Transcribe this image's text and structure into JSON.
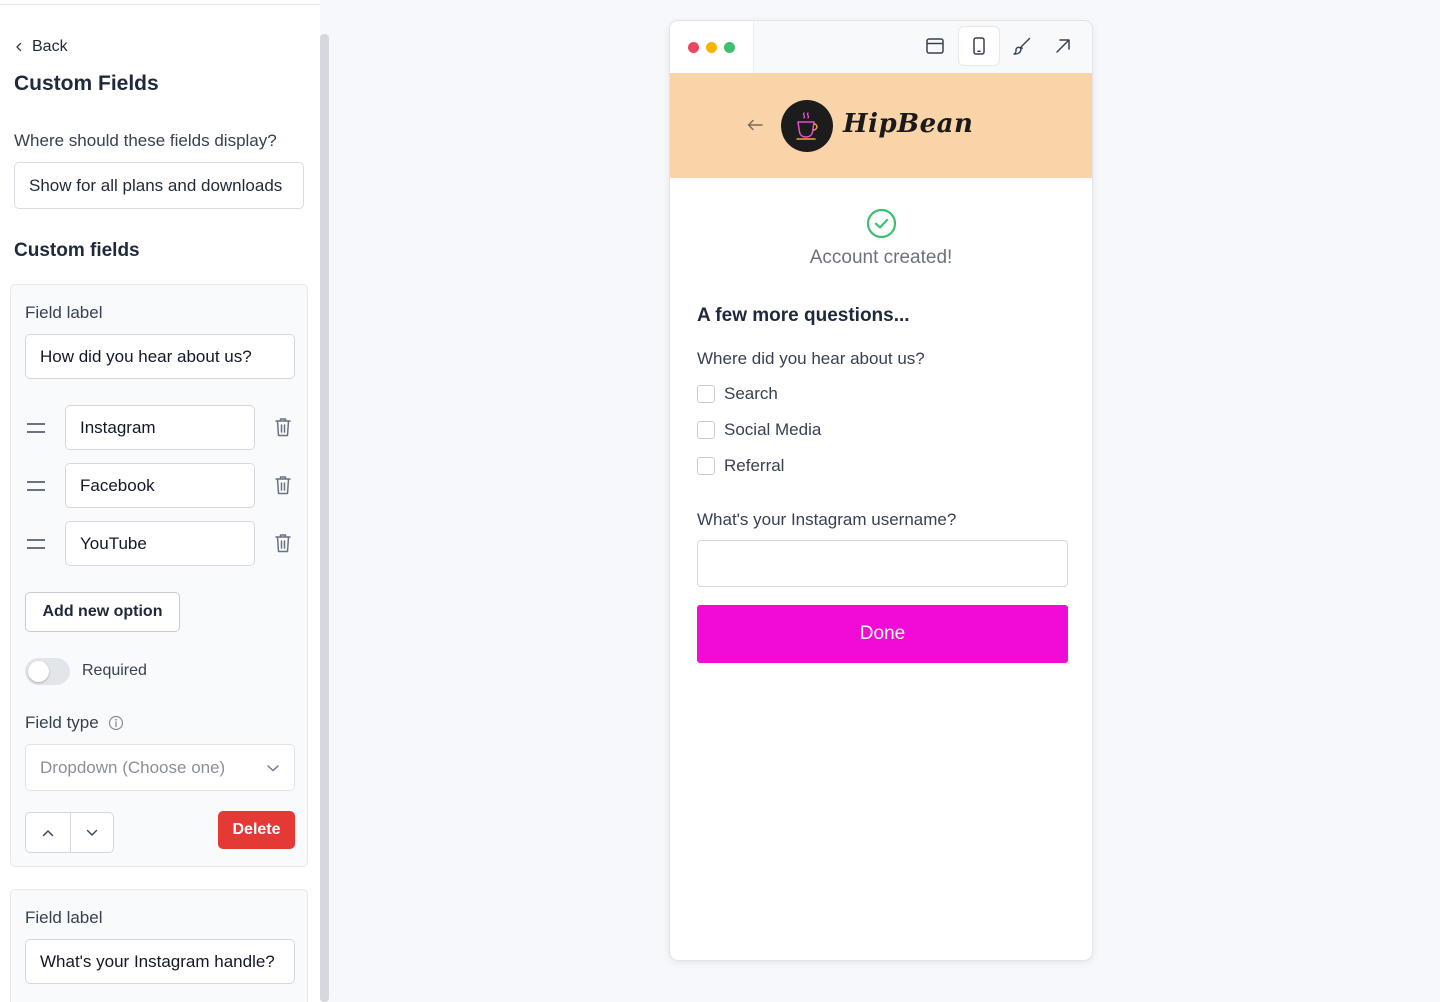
{
  "sidebar": {
    "back_label": "Back",
    "title": "Custom Fields",
    "display_question": "Where should these fields display?",
    "display_value": "Show for all plans and downloads",
    "section_title": "Custom fields",
    "field_1": {
      "label_caption": "Field label",
      "label_value": "How did you hear about us?",
      "options": [
        "Instagram",
        "Facebook",
        "YouTube"
      ],
      "add_option_label": "Add new option",
      "required_label": "Required",
      "required_on": false,
      "field_type_caption": "Field type",
      "field_type_value": "Dropdown (Choose one)",
      "delete_label": "Delete"
    },
    "field_2": {
      "label_caption": "Field label",
      "label_value": "What's your Instagram handle?"
    }
  },
  "preview": {
    "brand_name": "HipBean",
    "success_message": "Account created!",
    "questions_title": "A few more questions...",
    "question_1": "Where did you hear about us?",
    "question_1_options": [
      "Search",
      "Social Media",
      "Referral"
    ],
    "question_2": "What's your Instagram username?",
    "question_2_value": "",
    "done_label": "Done"
  },
  "icons": {
    "toolbar": [
      "browser-window-icon",
      "mobile-device-icon",
      "paintbrush-icon",
      "external-link-icon"
    ]
  },
  "colors": {
    "brand_header": "#f8d4a8",
    "done_button": "#f20ad6",
    "delete_button": "#e53935",
    "success_green": "#3fbf6f"
  }
}
